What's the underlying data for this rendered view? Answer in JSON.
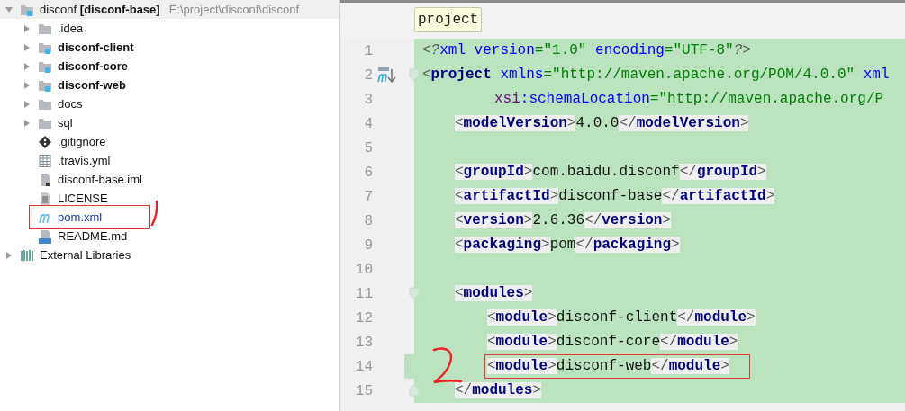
{
  "project_tree": [
    {
      "label": "disconf **[disconf-base]**",
      "path": "E:\\project\\disconf\\disconf",
      "kind": "module-root",
      "expanded": true,
      "children": [
        {
          "label": ".idea",
          "kind": "folder",
          "expanded": false
        },
        {
          "label": "disconf-client",
          "kind": "module",
          "expanded": false
        },
        {
          "label": "disconf-core",
          "kind": "module",
          "expanded": false
        },
        {
          "label": "disconf-web",
          "kind": "module",
          "expanded": false
        },
        {
          "label": "docs",
          "kind": "folder",
          "expanded": false
        },
        {
          "label": "sql",
          "kind": "folder",
          "expanded": false
        },
        {
          "label": ".gitignore",
          "kind": "git"
        },
        {
          "label": ".travis.yml",
          "kind": "table"
        },
        {
          "label": "disconf-base.iml",
          "kind": "iml"
        },
        {
          "label": "LICENSE",
          "kind": "text"
        },
        {
          "label": "pom.xml",
          "kind": "maven",
          "boxed": true
        },
        {
          "label": "README.md",
          "kind": "markdown"
        }
      ]
    },
    {
      "label": "External Libraries",
      "kind": "libraries",
      "expanded": false
    }
  ],
  "editor": {
    "breadcrumb_tooltip": "project",
    "lines": [
      {
        "number": "1",
        "tokens": [
          {
            "kind": "pi-bracket",
            "text": "<?"
          },
          {
            "kind": "attr",
            "text": "xml version"
          },
          {
            "kind": "value",
            "text": "=\"1.0\""
          },
          {
            "kind": "attr",
            "text": " encoding"
          },
          {
            "kind": "value",
            "text": "=\"UTF-8\""
          },
          {
            "kind": "pi-bracket",
            "text": "?>"
          }
        ]
      },
      {
        "number": "2",
        "fold_start": true,
        "maven_marker": true,
        "tokens": [
          {
            "kind": "bracket",
            "text": "<"
          },
          {
            "kind": "tag",
            "text": "project"
          },
          {
            "kind": "attr",
            "text": " xmlns"
          },
          {
            "kind": "value",
            "text": "=\"http://maven.apache.org/POM/4.0.0\""
          },
          {
            "kind": "attr",
            "text": " xml"
          }
        ],
        "children": [
          {
            "number": "3",
            "kind": "continuation",
            "tokens": [
              {
                "kind": "namespace",
                "text": "xsi"
              },
              {
                "kind": "attr",
                "text": ":schemaLocation"
              },
              {
                "kind": "value",
                "text": "=\"http://maven.apache.org/P"
              }
            ]
          },
          {
            "number": "4",
            "tokens": [
              {
                "kind": "bracket",
                "text": "<"
              },
              {
                "kind": "tag",
                "text": "modelVersion"
              },
              {
                "kind": "bracket",
                "text": ">"
              },
              {
                "kind": "text",
                "text": "4.0.0"
              },
              {
                "kind": "bracket",
                "text": "</"
              },
              {
                "kind": "tag",
                "text": "modelVersion"
              },
              {
                "kind": "bracket",
                "text": ">"
              }
            ]
          },
          {
            "number": "5"
          },
          {
            "number": "6",
            "tokens": [
              {
                "kind": "bracket",
                "text": "<"
              },
              {
                "kind": "tag",
                "text": "groupId"
              },
              {
                "kind": "bracket",
                "text": ">"
              },
              {
                "kind": "text",
                "text": "com.baidu.disconf"
              },
              {
                "kind": "bracket",
                "text": "</"
              },
              {
                "kind": "tag",
                "text": "groupId"
              },
              {
                "kind": "bracket",
                "text": ">"
              }
            ]
          },
          {
            "number": "7",
            "tokens": [
              {
                "kind": "bracket",
                "text": "<"
              },
              {
                "kind": "tag",
                "text": "artifactId"
              },
              {
                "kind": "bracket",
                "text": ">"
              },
              {
                "kind": "text",
                "text": "disconf-base"
              },
              {
                "kind": "bracket",
                "text": "</"
              },
              {
                "kind": "tag",
                "text": "artifactId"
              },
              {
                "kind": "bracket",
                "text": ">"
              }
            ]
          },
          {
            "number": "8",
            "tokens": [
              {
                "kind": "bracket",
                "text": "<"
              },
              {
                "kind": "tag",
                "text": "version"
              },
              {
                "kind": "bracket",
                "text": ">"
              },
              {
                "kind": "text",
                "text": "2.6.36"
              },
              {
                "kind": "bracket",
                "text": "</"
              },
              {
                "kind": "tag",
                "text": "version"
              },
              {
                "kind": "bracket",
                "text": ">"
              }
            ]
          },
          {
            "number": "9",
            "tokens": [
              {
                "kind": "bracket",
                "text": "<"
              },
              {
                "kind": "tag",
                "text": "packaging"
              },
              {
                "kind": "bracket",
                "text": ">"
              },
              {
                "kind": "text",
                "text": "pom"
              },
              {
                "kind": "bracket",
                "text": "</"
              },
              {
                "kind": "tag",
                "text": "packaging"
              },
              {
                "kind": "bracket",
                "text": ">"
              }
            ]
          },
          {
            "number": "10"
          },
          {
            "number": "11",
            "fold_start": true,
            "tokens": [
              {
                "kind": "bracket",
                "text": "<"
              },
              {
                "kind": "tag",
                "text": "modules"
              },
              {
                "kind": "bracket",
                "text": ">"
              }
            ],
            "children": [
              {
                "number": "12",
                "tokens": [
                  {
                    "kind": "bracket",
                    "text": "<"
                  },
                  {
                    "kind": "tag",
                    "text": "module"
                  },
                  {
                    "kind": "bracket",
                    "text": ">"
                  },
                  {
                    "kind": "text",
                    "text": "disconf-client"
                  },
                  {
                    "kind": "bracket",
                    "text": "</"
                  },
                  {
                    "kind": "tag",
                    "text": "module"
                  },
                  {
                    "kind": "bracket",
                    "text": ">"
                  }
                ]
              },
              {
                "number": "13",
                "tokens": [
                  {
                    "kind": "bracket",
                    "text": "<"
                  },
                  {
                    "kind": "tag",
                    "text": "module"
                  },
                  {
                    "kind": "bracket",
                    "text": ">"
                  },
                  {
                    "kind": "text",
                    "text": "disconf-core"
                  },
                  {
                    "kind": "bracket",
                    "text": "</"
                  },
                  {
                    "kind": "tag",
                    "text": "module"
                  },
                  {
                    "kind": "bracket",
                    "text": ">"
                  }
                ]
              },
              {
                "number": "14",
                "changed": true,
                "boxed": true,
                "tokens": [
                  {
                    "kind": "bracket",
                    "text": "<"
                  },
                  {
                    "kind": "tag",
                    "text": "module"
                  },
                  {
                    "kind": "bracket",
                    "text": ">"
                  },
                  {
                    "kind": "text",
                    "text": "disconf-web"
                  },
                  {
                    "kind": "bracket",
                    "text": "</"
                  },
                  {
                    "kind": "tag",
                    "text": "module"
                  },
                  {
                    "kind": "bracket",
                    "text": ">"
                  }
                ]
              }
            ]
          },
          {
            "number": "15",
            "fold_end": true,
            "tokens": [
              {
                "kind": "bracket",
                "text": "</"
              },
              {
                "kind": "tag",
                "text": "modules"
              },
              {
                "kind": "bracket",
                "text": ">"
              }
            ]
          }
        ]
      }
    ]
  }
}
